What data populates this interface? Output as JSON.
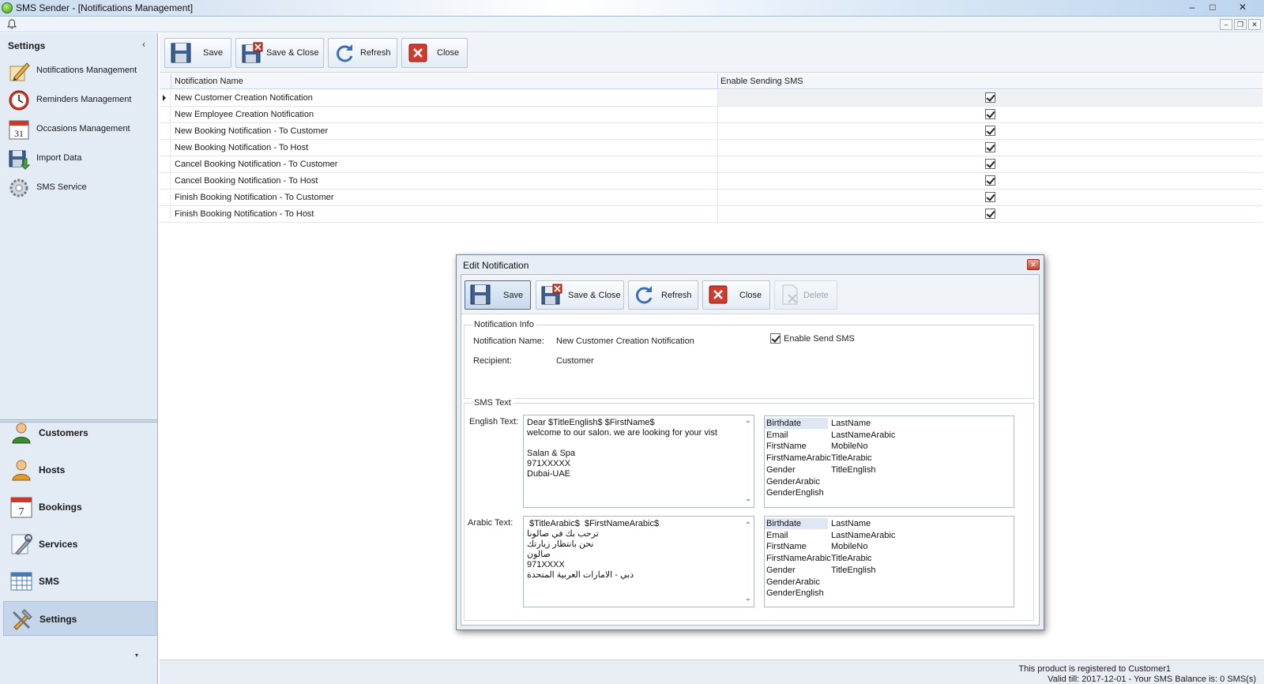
{
  "window": {
    "title": "SMS Sender - [Notifications Management]",
    "controls": [
      "–",
      "□",
      "✕"
    ],
    "mdi_controls": [
      "–",
      "❐",
      "✕"
    ]
  },
  "sidebar": {
    "header": "Settings",
    "collapse_glyph": "‹",
    "items": [
      {
        "label": "Notifications Management",
        "icon": "pencil-icon"
      },
      {
        "label": "Reminders Management",
        "icon": "clock-icon"
      },
      {
        "label": "Occasions Management",
        "icon": "calendar-icon"
      },
      {
        "label": "Import Data",
        "icon": "import-icon"
      },
      {
        "label": "SMS Service",
        "icon": "gear-icon"
      }
    ],
    "nav": [
      {
        "label": "Customers",
        "icon": "customer-icon"
      },
      {
        "label": "Hosts",
        "icon": "host-icon"
      },
      {
        "label": "Bookings",
        "icon": "calendar-icon"
      },
      {
        "label": "Services",
        "icon": "tools-icon"
      },
      {
        "label": "SMS",
        "icon": "grid-icon"
      },
      {
        "label": "Settings",
        "icon": "settings-icon"
      }
    ],
    "more_glyph": "▾"
  },
  "toolbar": {
    "save": "Save",
    "save_close": "Save & Close",
    "refresh": "Refresh",
    "close": "Close"
  },
  "grid": {
    "columns": [
      "Notification Name",
      "Enable Sending SMS"
    ],
    "rows": [
      {
        "name": "New Customer Creation Notification",
        "enabled": true
      },
      {
        "name": "New Employee Creation Notification",
        "enabled": true
      },
      {
        "name": "New Booking Notification - To Customer",
        "enabled": true
      },
      {
        "name": "New Booking Notification - To Host",
        "enabled": true
      },
      {
        "name": "Cancel Booking Notification - To Customer",
        "enabled": true
      },
      {
        "name": "Cancel Booking Notification - To Host",
        "enabled": true
      },
      {
        "name": "Finish Booking Notification - To Customer",
        "enabled": true
      },
      {
        "name": "Finish Booking Notification - To Host",
        "enabled": true
      }
    ]
  },
  "dialog": {
    "title": "Edit Notification",
    "close_glyph": "✕",
    "toolbar": {
      "save": "Save",
      "save_close": "Save & Close",
      "refresh": "Refresh",
      "close": "Close",
      "delete": "Delete"
    },
    "info": {
      "group_label": "Notification Info",
      "name_label": "Notification Name:",
      "name_value": "New Customer Creation Notification",
      "recipient_label": "Recipient:",
      "recipient_value": "Customer",
      "enable_label": "Enable Send SMS",
      "enable_checked": true
    },
    "sms": {
      "group_label": "SMS Text",
      "english_label": "English Text:",
      "english_lines": [
        "Dear $TitleEnglish$ $FirstName$",
        "welcome to our salon. we are looking for your vist",
        "",
        "Salan & Spa",
        "971XXXXX",
        "Dubai-UAE"
      ],
      "arabic_label": "Arabic Text:",
      "arabic_lines": [
        " $TitleArabic$  $FirstNameArabic$",
        "ترحب بك في صالونا",
        "نحن بانتظار زيارتك",
        "صالون",
        "971XXXX",
        "دبي - الامارات العربية المتحدة"
      ],
      "variables_col1": [
        "Birthdate",
        "Email",
        "FirstName",
        "FirstNameArabic",
        "Gender",
        "GenderArabic",
        "GenderEnglish"
      ],
      "variables_col2": [
        "LastName",
        "LastNameArabic",
        "MobileNo",
        "TitleArabic",
        "TitleEnglish"
      ]
    }
  },
  "status": {
    "line1": "This product is registered to Customer1",
    "line2": "Valid till: 2017-12-01 - Your SMS Balance is: 0 SMS(s)"
  }
}
